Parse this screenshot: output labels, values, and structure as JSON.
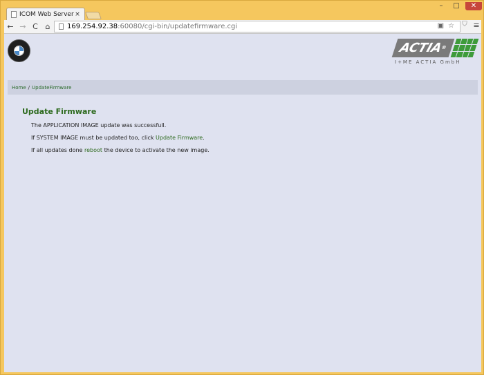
{
  "browser": {
    "tab_title": "ICOM Web Server -",
    "tab_close": "×",
    "url_host": "169.254.92.38",
    "url_path": ":60080/cgi-bin/updatefirmware.cgi",
    "window_minimize": "–",
    "window_maximize": "□",
    "window_close": "✕",
    "nav_back": "←",
    "nav_forward": "→",
    "nav_reload": "C",
    "nav_home": "⌂",
    "menu": "≡"
  },
  "logos": {
    "bmw_letters": "BMW",
    "actia_brand": "ACTIA",
    "actia_registered": "®",
    "actia_subline": "I+ME ACTIA GmbH"
  },
  "breadcrumb": {
    "home": "Home",
    "separator": "/",
    "current": "UpdateFirmware"
  },
  "content": {
    "title": "Update Firmware",
    "line1": "The APPLICATION IMAGE update was successfull.",
    "line2_before": "If SYSTEM IMAGE must be updated too, click ",
    "line2_link": "Update Firmware",
    "line2_after": ".",
    "line3_before": "If all updates done ",
    "line3_link": "reboot",
    "line3_after": " the device to activate the new image."
  },
  "colors": {
    "page_background": "#dfe2f0",
    "link_green": "#2d6a1e",
    "actia_green": "#3e9b3a",
    "window_frame": "#f5c75e"
  }
}
